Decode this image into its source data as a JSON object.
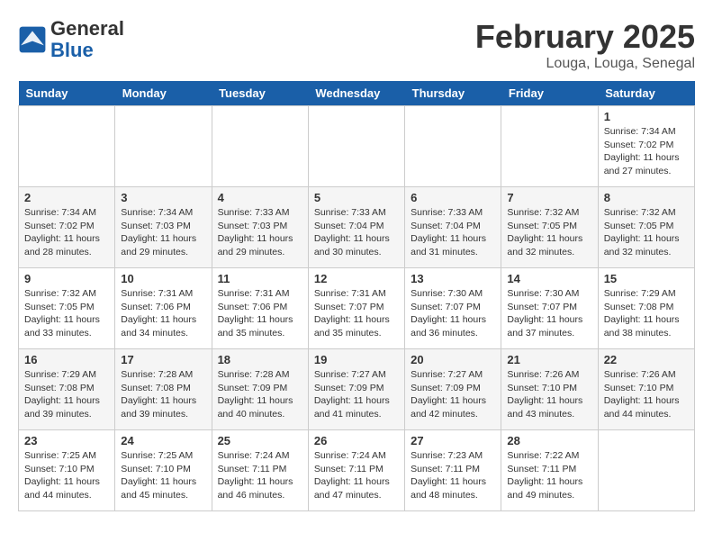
{
  "header": {
    "logo_general": "General",
    "logo_blue": "Blue",
    "month_title": "February 2025",
    "subtitle": "Louga, Louga, Senegal"
  },
  "weekdays": [
    "Sunday",
    "Monday",
    "Tuesday",
    "Wednesday",
    "Thursday",
    "Friday",
    "Saturday"
  ],
  "weeks": [
    [
      {
        "day": "",
        "info": ""
      },
      {
        "day": "",
        "info": ""
      },
      {
        "day": "",
        "info": ""
      },
      {
        "day": "",
        "info": ""
      },
      {
        "day": "",
        "info": ""
      },
      {
        "day": "",
        "info": ""
      },
      {
        "day": "1",
        "info": "Sunrise: 7:34 AM\nSunset: 7:02 PM\nDaylight: 11 hours and 27 minutes."
      }
    ],
    [
      {
        "day": "2",
        "info": "Sunrise: 7:34 AM\nSunset: 7:02 PM\nDaylight: 11 hours and 28 minutes."
      },
      {
        "day": "3",
        "info": "Sunrise: 7:34 AM\nSunset: 7:03 PM\nDaylight: 11 hours and 29 minutes."
      },
      {
        "day": "4",
        "info": "Sunrise: 7:33 AM\nSunset: 7:03 PM\nDaylight: 11 hours and 29 minutes."
      },
      {
        "day": "5",
        "info": "Sunrise: 7:33 AM\nSunset: 7:04 PM\nDaylight: 11 hours and 30 minutes."
      },
      {
        "day": "6",
        "info": "Sunrise: 7:33 AM\nSunset: 7:04 PM\nDaylight: 11 hours and 31 minutes."
      },
      {
        "day": "7",
        "info": "Sunrise: 7:32 AM\nSunset: 7:05 PM\nDaylight: 11 hours and 32 minutes."
      },
      {
        "day": "8",
        "info": "Sunrise: 7:32 AM\nSunset: 7:05 PM\nDaylight: 11 hours and 32 minutes."
      }
    ],
    [
      {
        "day": "9",
        "info": "Sunrise: 7:32 AM\nSunset: 7:05 PM\nDaylight: 11 hours and 33 minutes."
      },
      {
        "day": "10",
        "info": "Sunrise: 7:31 AM\nSunset: 7:06 PM\nDaylight: 11 hours and 34 minutes."
      },
      {
        "day": "11",
        "info": "Sunrise: 7:31 AM\nSunset: 7:06 PM\nDaylight: 11 hours and 35 minutes."
      },
      {
        "day": "12",
        "info": "Sunrise: 7:31 AM\nSunset: 7:07 PM\nDaylight: 11 hours and 35 minutes."
      },
      {
        "day": "13",
        "info": "Sunrise: 7:30 AM\nSunset: 7:07 PM\nDaylight: 11 hours and 36 minutes."
      },
      {
        "day": "14",
        "info": "Sunrise: 7:30 AM\nSunset: 7:07 PM\nDaylight: 11 hours and 37 minutes."
      },
      {
        "day": "15",
        "info": "Sunrise: 7:29 AM\nSunset: 7:08 PM\nDaylight: 11 hours and 38 minutes."
      }
    ],
    [
      {
        "day": "16",
        "info": "Sunrise: 7:29 AM\nSunset: 7:08 PM\nDaylight: 11 hours and 39 minutes."
      },
      {
        "day": "17",
        "info": "Sunrise: 7:28 AM\nSunset: 7:08 PM\nDaylight: 11 hours and 39 minutes."
      },
      {
        "day": "18",
        "info": "Sunrise: 7:28 AM\nSunset: 7:09 PM\nDaylight: 11 hours and 40 minutes."
      },
      {
        "day": "19",
        "info": "Sunrise: 7:27 AM\nSunset: 7:09 PM\nDaylight: 11 hours and 41 minutes."
      },
      {
        "day": "20",
        "info": "Sunrise: 7:27 AM\nSunset: 7:09 PM\nDaylight: 11 hours and 42 minutes."
      },
      {
        "day": "21",
        "info": "Sunrise: 7:26 AM\nSunset: 7:10 PM\nDaylight: 11 hours and 43 minutes."
      },
      {
        "day": "22",
        "info": "Sunrise: 7:26 AM\nSunset: 7:10 PM\nDaylight: 11 hours and 44 minutes."
      }
    ],
    [
      {
        "day": "23",
        "info": "Sunrise: 7:25 AM\nSunset: 7:10 PM\nDaylight: 11 hours and 44 minutes."
      },
      {
        "day": "24",
        "info": "Sunrise: 7:25 AM\nSunset: 7:10 PM\nDaylight: 11 hours and 45 minutes."
      },
      {
        "day": "25",
        "info": "Sunrise: 7:24 AM\nSunset: 7:11 PM\nDaylight: 11 hours and 46 minutes."
      },
      {
        "day": "26",
        "info": "Sunrise: 7:24 AM\nSunset: 7:11 PM\nDaylight: 11 hours and 47 minutes."
      },
      {
        "day": "27",
        "info": "Sunrise: 7:23 AM\nSunset: 7:11 PM\nDaylight: 11 hours and 48 minutes."
      },
      {
        "day": "28",
        "info": "Sunrise: 7:22 AM\nSunset: 7:11 PM\nDaylight: 11 hours and 49 minutes."
      },
      {
        "day": "",
        "info": ""
      }
    ]
  ]
}
